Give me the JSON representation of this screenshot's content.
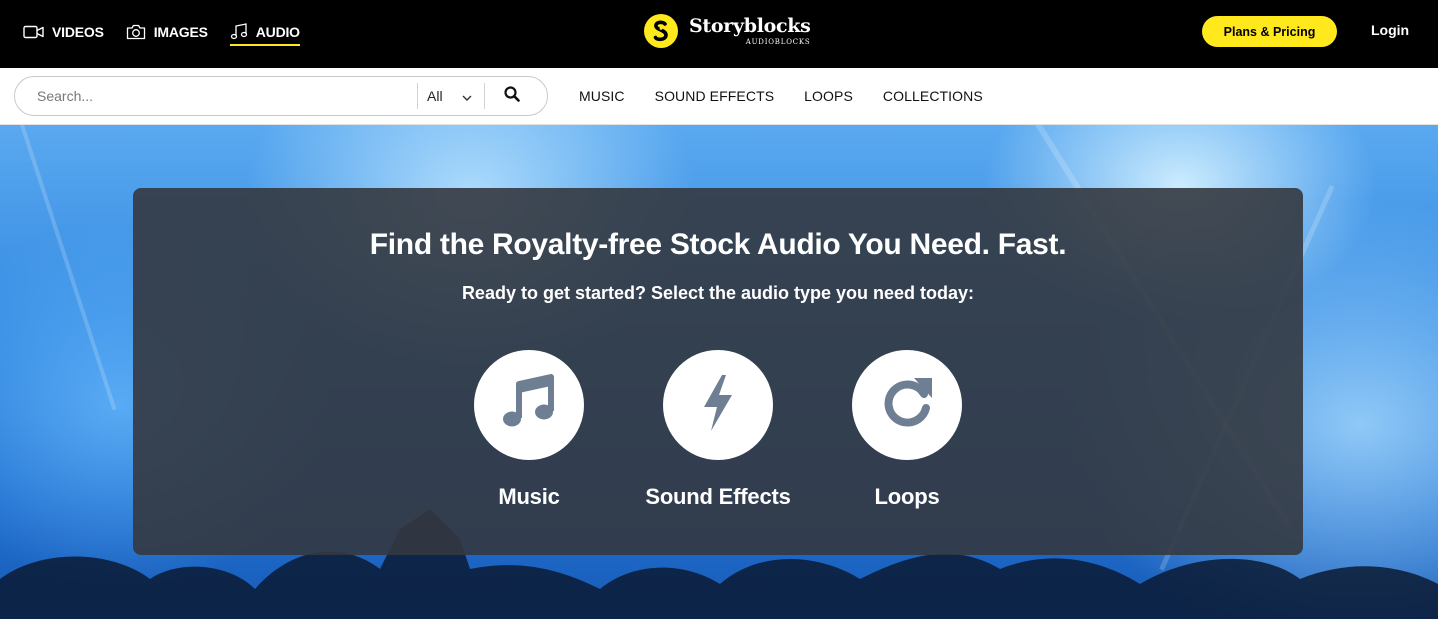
{
  "header": {
    "media_tabs": [
      {
        "label": "VIDEOS",
        "icon": "video-camera-icon",
        "active": false
      },
      {
        "label": "IMAGES",
        "icon": "camera-icon",
        "active": false
      },
      {
        "label": "AUDIO",
        "icon": "music-note-icon",
        "active": true
      }
    ],
    "logo": {
      "name": "Storyblocks",
      "sub": "AUDIOBLOCKS"
    },
    "plans_label": "Plans & Pricing",
    "login_label": "Login",
    "accent_color": "#ffe81c"
  },
  "search": {
    "placeholder": "Search...",
    "value": "",
    "scope": "All"
  },
  "category_nav": [
    "MUSIC",
    "SOUND EFFECTS",
    "LOOPS",
    "COLLECTIONS"
  ],
  "hero": {
    "headline": "Find the Royalty-free Stock Audio You Need. Fast.",
    "subline": "Ready to get started? Select the audio type you need today:",
    "choices": [
      {
        "label": "Music",
        "icon": "music-note-icon"
      },
      {
        "label": "Sound Effects",
        "icon": "lightning-bolt-icon"
      },
      {
        "label": "Loops",
        "icon": "refresh-loop-icon"
      }
    ]
  }
}
